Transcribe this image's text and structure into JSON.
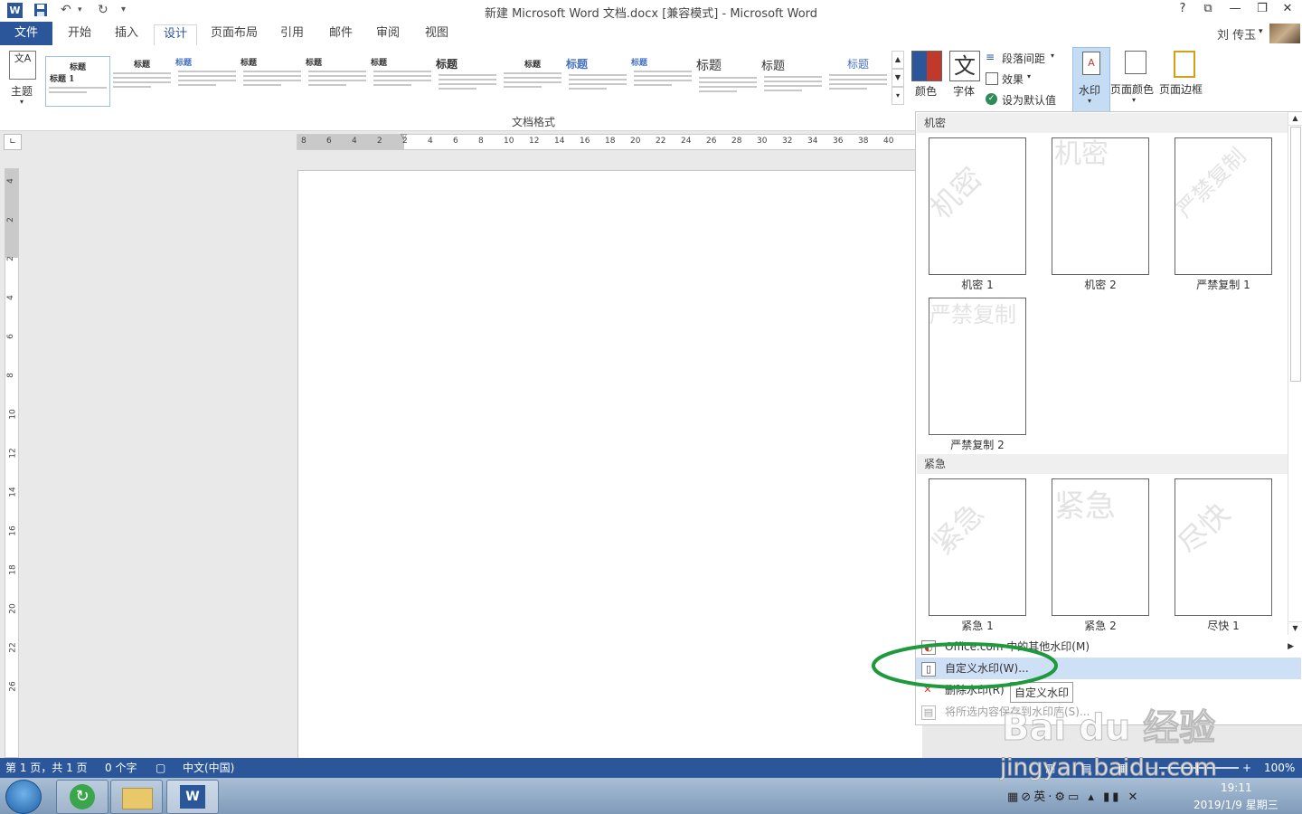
{
  "window": {
    "title": "新建 Microsoft Word 文档.docx [兼容模式] - Microsoft Word",
    "help": "?",
    "user": "刘 传玉"
  },
  "tabs": [
    {
      "label": "文件"
    },
    {
      "label": "开始"
    },
    {
      "label": "插入"
    },
    {
      "label": "设计"
    },
    {
      "label": "页面布局"
    },
    {
      "label": "引用"
    },
    {
      "label": "邮件"
    },
    {
      "label": "审阅"
    },
    {
      "label": "视图"
    }
  ],
  "ribbon": {
    "theme_label": "主题",
    "document_format_group": "文档格式",
    "style_heading_label": "标题",
    "style_heading1_label": "标题 1",
    "colors_label": "颜色",
    "fonts_label": "字体",
    "font_glyph": "文",
    "paragraph_spacing_label": "段落间距",
    "effects_label": "效果",
    "set_default_label": "设为默认值",
    "watermark_label": "水印",
    "page_color_label": "页面颜色",
    "page_border_label": "页面边框"
  },
  "ruler": {
    "horizontal_ticks": [
      "8",
      "6",
      "4",
      "2",
      "2",
      "4",
      "6",
      "8",
      "10",
      "12",
      "14",
      "16",
      "18",
      "20",
      "22",
      "24",
      "26",
      "28",
      "30",
      "32",
      "34",
      "36",
      "38",
      "40"
    ],
    "vertical_ticks": [
      "4",
      "2",
      "2",
      "4",
      "6",
      "8",
      "10",
      "12",
      "14",
      "16",
      "18",
      "20",
      "22",
      "26"
    ]
  },
  "gallery": {
    "sections": [
      {
        "name": "机密",
        "items": [
          {
            "caption": "机密 1",
            "text": "机密",
            "style": "diagonal"
          },
          {
            "caption": "机密 2",
            "text": "机密",
            "style": "horizontal"
          },
          {
            "caption": "严禁复制 1",
            "text": "严禁复制",
            "style": "diagonal"
          },
          {
            "caption": "严禁复制 2",
            "text": "严禁复制",
            "style": "horizontal"
          }
        ]
      },
      {
        "name": "紧急",
        "items": [
          {
            "caption": "紧急 1",
            "text": "紧急",
            "style": "diagonal"
          },
          {
            "caption": "紧急 2",
            "text": "紧急",
            "style": "horizontal"
          },
          {
            "caption": "尽快 1",
            "text": "尽快",
            "style": "diagonal"
          }
        ]
      }
    ]
  },
  "menu": {
    "items": [
      {
        "label": "Office.com 中的其他水印(M)",
        "enabled": true
      },
      {
        "label": "自定义水印(W)...",
        "enabled": true,
        "highlighted": true
      },
      {
        "label": "删除水印(R)",
        "enabled": true
      },
      {
        "label": "将所选内容保存到水印库(S)...",
        "enabled": false
      }
    ],
    "tooltip": "自定义水印"
  },
  "statusbar": {
    "page": "第 1 页，共 1 页",
    "words": "0 个字",
    "language": "中文(中国)",
    "zoom": "100%",
    "zoom_minus": "−",
    "zoom_plus": "+"
  },
  "taskbar": {
    "time": "19:11",
    "date": "2019/1/9 星期三",
    "ime": "英"
  },
  "overlay": {
    "watermark_text": "jingyan.baidu.com",
    "logo_text": "Bai du 经验"
  },
  "colors": {
    "accent": "#2b579a",
    "highlight": "#cde0f5",
    "annotation_ellipse": "#1e9a3c"
  }
}
